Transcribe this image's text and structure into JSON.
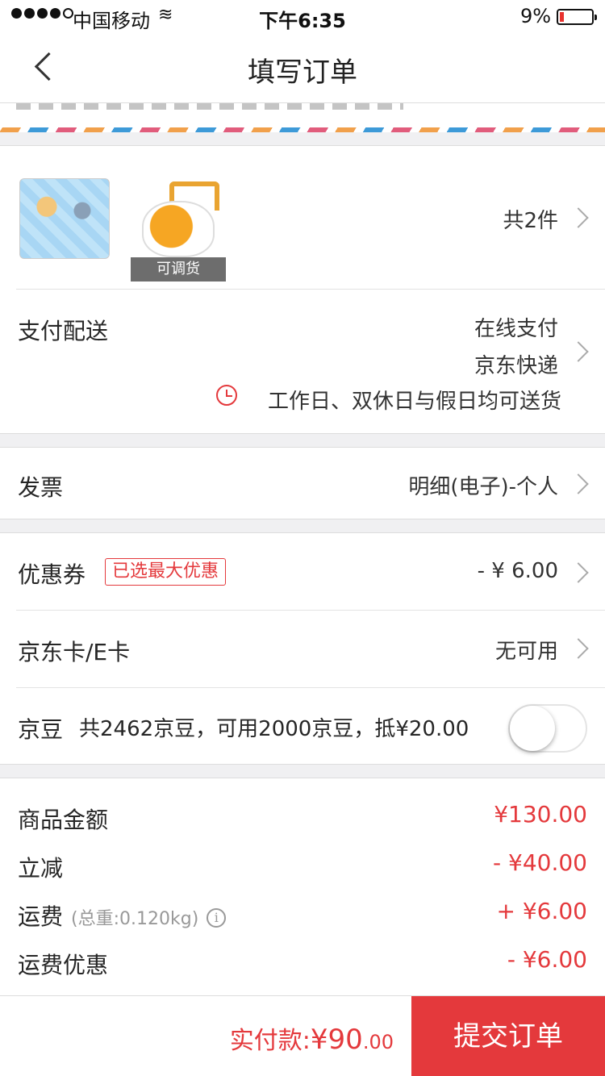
{
  "status_bar": {
    "carrier": "中国移动",
    "time": "下午6:35",
    "battery": "9%",
    "battery_level": 0.09
  },
  "nav": {
    "title": "填写订单"
  },
  "products": {
    "badge": "可调货",
    "count_label": "共2件"
  },
  "payment_delivery": {
    "label": "支付配送",
    "payment_method": "在线支付",
    "delivery_method": "京东快递",
    "delivery_note": "工作日、双休日与假日均可送货"
  },
  "invoice": {
    "label": "发票",
    "value": "明细(电子)-个人"
  },
  "coupon": {
    "label": "优惠券",
    "badge": "已选最大优惠",
    "value": "- ¥ 6.00"
  },
  "jd_card": {
    "label": "京东卡/E卡",
    "value": "无可用"
  },
  "jd_beans": {
    "label": "京豆",
    "detail": "共2462京豆，可用2000京豆，抵¥20.00",
    "enabled": false
  },
  "summary": {
    "goods_label": "商品金额",
    "goods_value": "¥130.00",
    "discount_label": "立减",
    "discount_value": "- ¥40.00",
    "shipping_label": "运费",
    "shipping_weight": "(总重:0.120kg)",
    "shipping_value": "+ ¥6.00",
    "shipping_discount_label": "运费优惠",
    "shipping_discount_value": "- ¥6.00"
  },
  "bottom": {
    "pay_label": "实付款:",
    "pay_currency_int": "¥90",
    "pay_decimal": ".00",
    "submit_label": "提交订单"
  },
  "colors": {
    "accent": "#e4393c",
    "background": "#f0f0f2"
  }
}
